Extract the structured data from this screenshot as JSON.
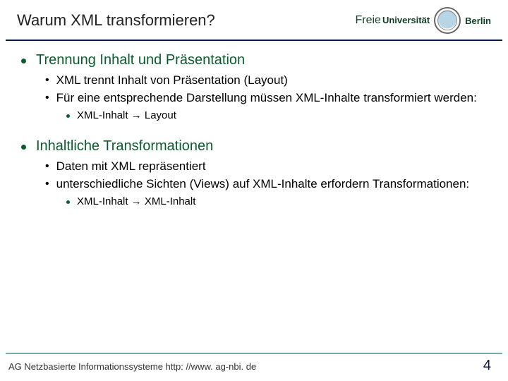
{
  "header": {
    "title": "Warum XML transformieren?",
    "uni_freie": "Freie",
    "uni_universitat": "Universität",
    "uni_berlin": "Berlin"
  },
  "sections": [
    {
      "heading": "Trennung Inhalt und Präsentation",
      "subs": [
        "XML trennt Inhalt von Präsentation (Layout)",
        "Für eine entsprechende Darstellung müssen XML-Inhalte transformiert werden:"
      ],
      "subsub": "XML-Inhalt → Layout"
    },
    {
      "heading": "Inhaltliche Transformationen",
      "subs": [
        "Daten mit XML repräsentiert",
        "unterschiedliche Sichten (Views) auf XML-Inhalte erfordern Transformationen:"
      ],
      "subsub": "XML-Inhalt → XML-Inhalt"
    }
  ],
  "footer": {
    "org": "AG Netzbasierte Informationssysteme",
    "url": "http: //www. ag-nbi. de",
    "page": "4"
  }
}
